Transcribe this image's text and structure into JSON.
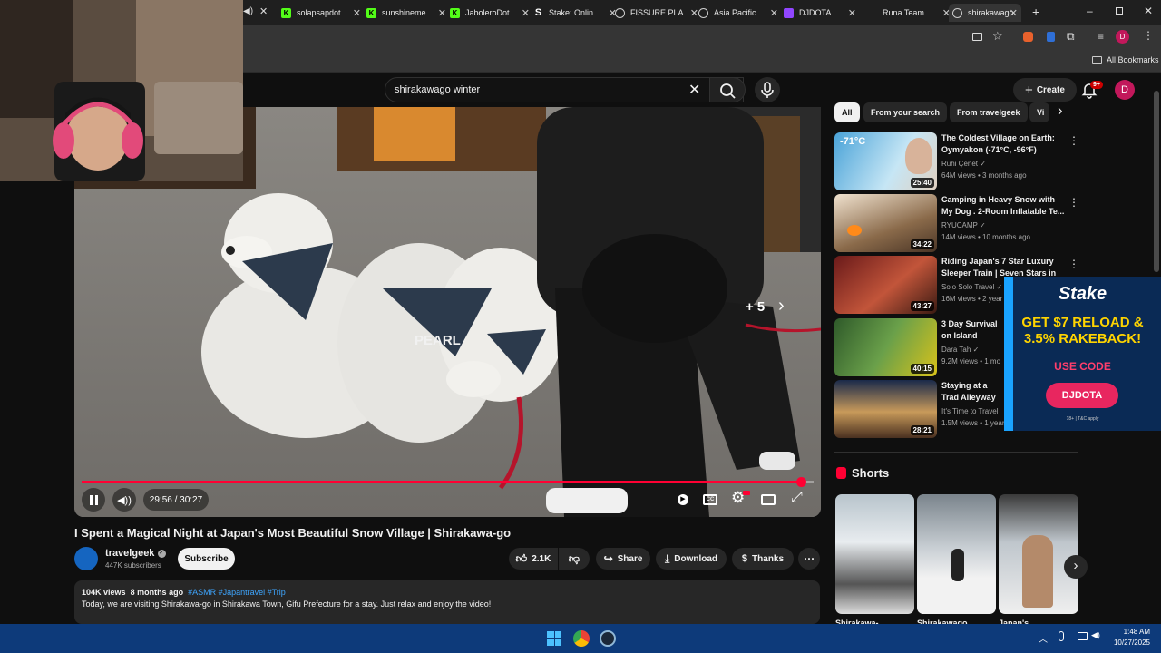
{
  "browser": {
    "tabs": [
      {
        "title": "",
        "color": "#ffffff"
      },
      {
        "title": "solapsapdot",
        "color": "#53fc18"
      },
      {
        "title": "sunshineme",
        "color": "#53fc18"
      },
      {
        "title": "JaboleroDot",
        "color": "#53fc18"
      },
      {
        "title": "Stake: Onlin",
        "color": "#ffffff"
      },
      {
        "title": "FISSURE PLA",
        "color": "#ffffff"
      },
      {
        "title": "Asia Pacific",
        "color": "#ffffff"
      },
      {
        "title": "DJDOTA",
        "color": "#9146ff"
      },
      {
        "title": "Runa Team",
        "color": "#ffffff"
      },
      {
        "title": "shirakawago",
        "color": "#ffffff"
      }
    ],
    "bookmarks_label": "All Bookmarks",
    "profile_letter": "D"
  },
  "masthead": {
    "search_query": "shirakawago winter",
    "create_label": "Create",
    "notif_badge": "9+",
    "avatar_letter": "D"
  },
  "player": {
    "time_current": "29:56",
    "time_total": "30:27",
    "time_display": "29:56 / 30:27",
    "progress": 0.983,
    "overlay_count": "+ 5",
    "scarf_text_1": "PEARL"
  },
  "video": {
    "title": "I Spent a Magical Night at Japan's Most Beautiful Snow Village | Shirakawa-go",
    "channel": "travelgeek",
    "subscribers": "447K subscribers",
    "subscribe_label": "Subscribe",
    "likes": "2.1K",
    "share_label": "Share",
    "download_label": "Download",
    "thanks_label": "Thanks",
    "views": "104K views",
    "age": "8 months ago",
    "tags": "#ASMR #Japantravel #Trip",
    "description": "Today, we are visiting Shirakawa-go in Shirakawa Town, Gifu Prefecture for a stay. Just relax and enjoy the video!"
  },
  "chips": [
    {
      "label": "All",
      "active": true
    },
    {
      "label": "From your search",
      "active": false
    },
    {
      "label": "From travelgeek",
      "active": false
    },
    {
      "label": "Vi",
      "active": false
    }
  ],
  "recommendations": [
    {
      "title": "The Coldest Village on Earth: Oymyakon (-71°C, -96°F)",
      "channel": "Ruhi Çenet",
      "meta": "64M views • 3 months ago",
      "duration": "25:40",
      "thumb_text": "-71°C"
    },
    {
      "title": "Camping in Heavy Snow with My Dog . 2-Room Inflatable Te...",
      "channel": "RYUCAMP",
      "meta": "14M views • 10 months ago",
      "duration": "34:22"
    },
    {
      "title": "Riding Japan's 7 Star Luxury Sleeper Train | Seven Stars in",
      "channel": "Solo Solo Travel",
      "meta": "16M views • 2 year",
      "duration": "43:27"
    },
    {
      "title": "3 Day Survival on Island",
      "channel": "Dara Tah",
      "meta": "9.2M views • 1 mo",
      "duration": "40:15"
    },
    {
      "title": "Staying at a Trad Alleyway Turned",
      "channel": "It's Time to Travel",
      "meta": "1.5M views • 1 year",
      "duration": "28:21"
    }
  ],
  "shorts": {
    "heading": "Shorts",
    "items": [
      {
        "label": "Shirakawa-"
      },
      {
        "label": "Shirakawago"
      },
      {
        "label": "Japan's"
      }
    ]
  },
  "ad": {
    "brand": "Stake",
    "headline_1": "GET $7 RELOAD &",
    "headline_2": "3.5% RAKEBACK!",
    "use_code": "USE CODE",
    "code": "DJDOTA",
    "fineprint": "18+ | T&C apply"
  },
  "taskbar": {
    "time": "1:48 AM",
    "date": "10/27/2025"
  }
}
